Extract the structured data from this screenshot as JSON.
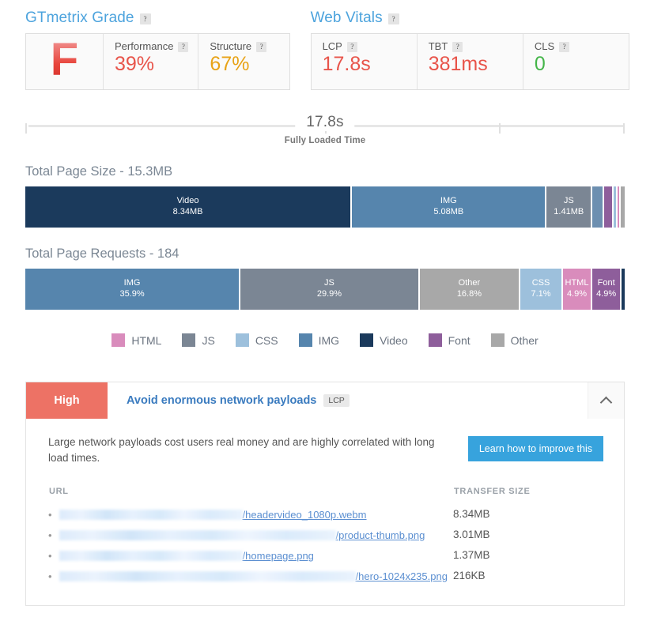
{
  "grade_section": {
    "title": "GTmetrix Grade",
    "help": "?",
    "grade": "F",
    "metrics": [
      {
        "label": "Performance",
        "value": "39%",
        "help": "?"
      },
      {
        "label": "Structure",
        "value": "67%",
        "help": "?"
      }
    ]
  },
  "vitals_section": {
    "title": "Web Vitals",
    "help": "?",
    "metrics": [
      {
        "label": "LCP",
        "value": "17.8s",
        "help": "?"
      },
      {
        "label": "TBT",
        "value": "381ms",
        "help": "?"
      },
      {
        "label": "CLS",
        "value": "0",
        "help": "?"
      }
    ]
  },
  "fully_loaded": {
    "time": "17.8s",
    "label": "Fully Loaded Time"
  },
  "chart_data": [
    {
      "type": "bar",
      "orientation": "stacked-horizontal",
      "title": "Total Page Size - 15.3MB",
      "total": "15.3MB",
      "categories": [
        "Video",
        "IMG",
        "JS",
        "IMG",
        "Font",
        "CSS",
        "HTML",
        "Other"
      ],
      "values": [
        8.34,
        5.08,
        1.41,
        0.28,
        0.13,
        0.04,
        0.03,
        0.03
      ],
      "unit": "MB",
      "labels": [
        "8.34MB",
        "5.08MB",
        "1.41MB",
        "",
        "",
        "",
        "",
        ""
      ],
      "widths_pct": [
        54.5,
        32.5,
        7.6,
        2.0,
        1.5,
        0.7,
        0.6,
        0.6
      ],
      "colors": [
        "#1b3a5c",
        "#5685ad",
        "#7b8694",
        "#6d8fb0",
        "#8e5e9b",
        "#9dc0dc",
        "#d98cbc",
        "#a8a8a8"
      ]
    },
    {
      "type": "bar",
      "orientation": "stacked-horizontal",
      "title": "Total Page Requests - 184",
      "total": "184",
      "categories": [
        "IMG",
        "JS",
        "Other",
        "CSS",
        "HTML",
        "Font",
        "Video"
      ],
      "values": [
        35.9,
        29.9,
        16.8,
        7.1,
        4.9,
        4.9,
        0.5
      ],
      "unit": "%",
      "labels": [
        "35.9%",
        "29.9%",
        "16.8%",
        "7.1%",
        "4.9%",
        "4.9%",
        ""
      ],
      "widths_pct": [
        35.9,
        29.9,
        16.8,
        7.1,
        4.9,
        4.9,
        0.5
      ],
      "colors": [
        "#5685ad",
        "#7b8694",
        "#a8a8a8",
        "#9dc0dc",
        "#d98cbc",
        "#8e5e9b",
        "#1b3a5c"
      ]
    }
  ],
  "legend": [
    {
      "label": "HTML",
      "color": "#d98cbc"
    },
    {
      "label": "JS",
      "color": "#7b8694"
    },
    {
      "label": "CSS",
      "color": "#9dc0dc"
    },
    {
      "label": "IMG",
      "color": "#5685ad"
    },
    {
      "label": "Video",
      "color": "#1b3a5c"
    },
    {
      "label": "Font",
      "color": "#8e5e9b"
    },
    {
      "label": "Other",
      "color": "#a8a8a8"
    }
  ],
  "recommendation": {
    "severity": "High",
    "title": "Avoid enormous network payloads",
    "tag": "LCP",
    "description": "Large network payloads cost users real money and are highly correlated with long load times.",
    "cta": "Learn how to improve this",
    "table": {
      "col_url": "URL",
      "col_size": "TRANSFER SIZE",
      "rows": [
        {
          "url_suffix": "/headervideo_1080p.webm",
          "blur_width": 232,
          "size": "8.34MB"
        },
        {
          "url_suffix": "/product-thumb.png",
          "blur_width": 350,
          "size": "3.01MB"
        },
        {
          "url_suffix": "/homepage.png",
          "blur_width": 232,
          "size": "1.37MB"
        },
        {
          "url_suffix": "/hero-1024x235.png",
          "blur_width": 375,
          "size": "216KB"
        }
      ]
    }
  }
}
